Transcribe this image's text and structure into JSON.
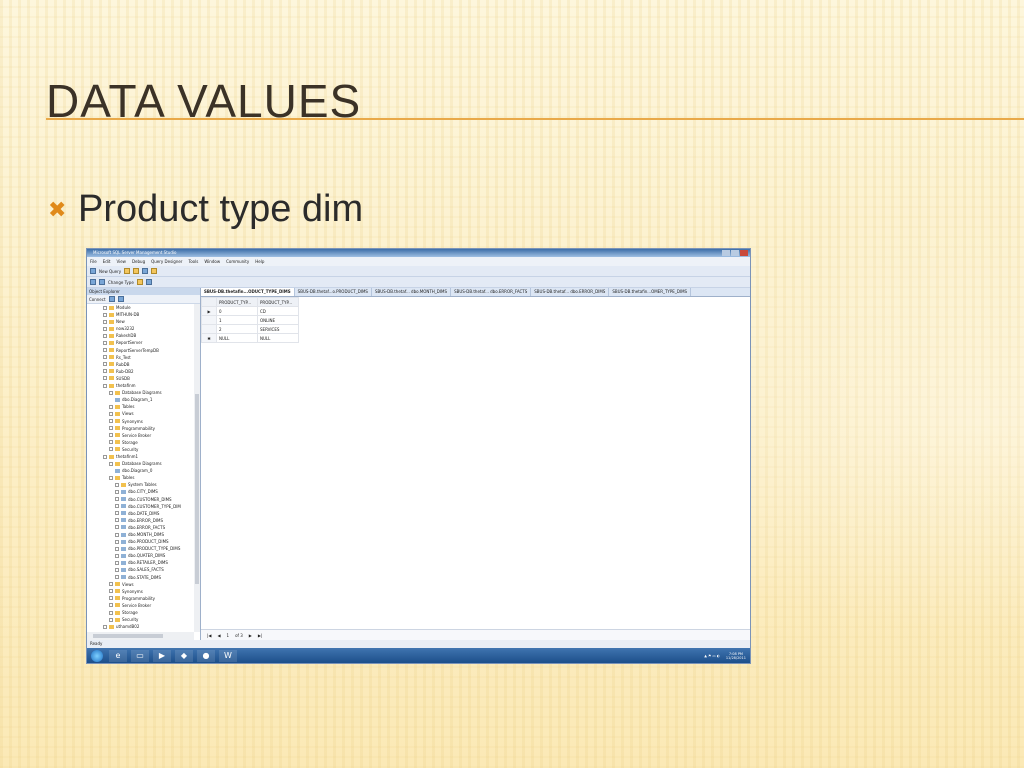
{
  "slide": {
    "title": "DATA VALUES",
    "bullet": "Product type dim",
    "bullet_icon": "x-mark-bullet-icon",
    "accent": "#e9a949"
  },
  "screenshot": {
    "app_title": "Microsoft SQL Server Management Studio",
    "menu": [
      "File",
      "Edit",
      "View",
      "Debug",
      "Query Designer",
      "Tools",
      "Window",
      "Community",
      "Help"
    ],
    "toolbar": {
      "new_query": "New Query",
      "change_type": "Change Type"
    },
    "explorer": {
      "title": "Object Explorer",
      "connect": "Connect",
      "nodes": [
        {
          "label": "Module",
          "kind": "db",
          "level": 0
        },
        {
          "label": "MITHUN-DB",
          "kind": "db",
          "level": 0
        },
        {
          "label": "New",
          "kind": "db",
          "level": 0
        },
        {
          "label": "now3232",
          "kind": "db",
          "level": 0
        },
        {
          "label": "RakeshDB",
          "kind": "db",
          "level": 0
        },
        {
          "label": "ReportServer",
          "kind": "db",
          "level": 0
        },
        {
          "label": "ReportServerTempDB",
          "kind": "db",
          "level": 0
        },
        {
          "label": "Rs_Test",
          "kind": "db",
          "level": 0
        },
        {
          "label": "RubDB",
          "kind": "db",
          "level": 0
        },
        {
          "label": "Rub-DB2",
          "kind": "db",
          "level": 0
        },
        {
          "label": "SUSDB",
          "kind": "db",
          "level": 0
        },
        {
          "label": "thetafinm",
          "kind": "db",
          "level": 0
        },
        {
          "label": "Database Diagrams",
          "kind": "folder",
          "level": 1
        },
        {
          "label": "dbo.Diagram_1",
          "kind": "item",
          "level": 2
        },
        {
          "label": "Tables",
          "kind": "folder",
          "level": 1
        },
        {
          "label": "Views",
          "kind": "folder",
          "level": 1
        },
        {
          "label": "Synonyms",
          "kind": "folder",
          "level": 1
        },
        {
          "label": "Programmability",
          "kind": "folder",
          "level": 1
        },
        {
          "label": "Service Broker",
          "kind": "folder",
          "level": 1
        },
        {
          "label": "Storage",
          "kind": "folder",
          "level": 1
        },
        {
          "label": "Security",
          "kind": "folder",
          "level": 1
        },
        {
          "label": "thetafinm1",
          "kind": "db",
          "level": 0
        },
        {
          "label": "Database Diagrams",
          "kind": "folder",
          "level": 1
        },
        {
          "label": "dbo.Diagram_0",
          "kind": "item",
          "level": 2
        },
        {
          "label": "Tables",
          "kind": "folder",
          "level": 1
        },
        {
          "label": "System Tables",
          "kind": "folder",
          "level": 2
        },
        {
          "label": "dbo.CITY_DIMS",
          "kind": "table",
          "level": 2
        },
        {
          "label": "dbo.CUSTOMER_DIMS",
          "kind": "table",
          "level": 2
        },
        {
          "label": "dbo.CUSTOMER_TYPE_DIM",
          "kind": "table",
          "level": 2
        },
        {
          "label": "dbo.DATE_DIMS",
          "kind": "table",
          "level": 2
        },
        {
          "label": "dbo.ERROR_DIMS",
          "kind": "table",
          "level": 2
        },
        {
          "label": "dbo.ERROR_FACTS",
          "kind": "table",
          "level": 2
        },
        {
          "label": "dbo.MONTH_DIMS",
          "kind": "table",
          "level": 2
        },
        {
          "label": "dbo.PRODUCT_DIMS",
          "kind": "table",
          "level": 2
        },
        {
          "label": "dbo.PRODUCT_TYPE_DIMS",
          "kind": "table",
          "level": 2
        },
        {
          "label": "dbo.QUATER_DIMS",
          "kind": "table",
          "level": 2
        },
        {
          "label": "dbo.RETAILER_DIMS",
          "kind": "table",
          "level": 2
        },
        {
          "label": "dbo.SALES_FACTS",
          "kind": "table",
          "level": 2
        },
        {
          "label": "dbo.STATE_DIMS",
          "kind": "table",
          "level": 2
        },
        {
          "label": "Views",
          "kind": "folder",
          "level": 1
        },
        {
          "label": "Synonyms",
          "kind": "folder",
          "level": 1
        },
        {
          "label": "Programmability",
          "kind": "folder",
          "level": 1
        },
        {
          "label": "Service Broker",
          "kind": "folder",
          "level": 1
        },
        {
          "label": "Storage",
          "kind": "folder",
          "level": 1
        },
        {
          "label": "Security",
          "kind": "folder",
          "level": 1
        },
        {
          "label": "uthamdB02",
          "kind": "db",
          "level": 0
        }
      ]
    },
    "tabs": [
      "SBUS-DB.thetafin...ODUCT_TYPE_DIMS",
      "SBUS-DB.thetaf...o.PRODUCT_DIMS",
      "SBUS-DB.thetaf... dbo.MONTH_DIMS",
      "SBUS-DB.thetaf... dbo.ERROR_FACTS",
      "SBUS-DB.thetaf... dbo.ERROR_DIMS",
      "SBUS-DB.thetafin...OMER_TYPE_DIMS"
    ],
    "grid": {
      "columns": [
        "PRODUCT_TYP...",
        "PRODUCT_TYP..."
      ],
      "rows": [
        [
          "0",
          "CD"
        ],
        [
          "1",
          "ONLINE"
        ],
        [
          "2",
          "SERVICES"
        ],
        [
          "NULL",
          "NULL"
        ]
      ]
    },
    "nav": {
      "page": "1",
      "of": "of 3"
    },
    "status": "Ready",
    "clock": {
      "time": "7:08 PM",
      "date": "11/28/2011"
    }
  }
}
